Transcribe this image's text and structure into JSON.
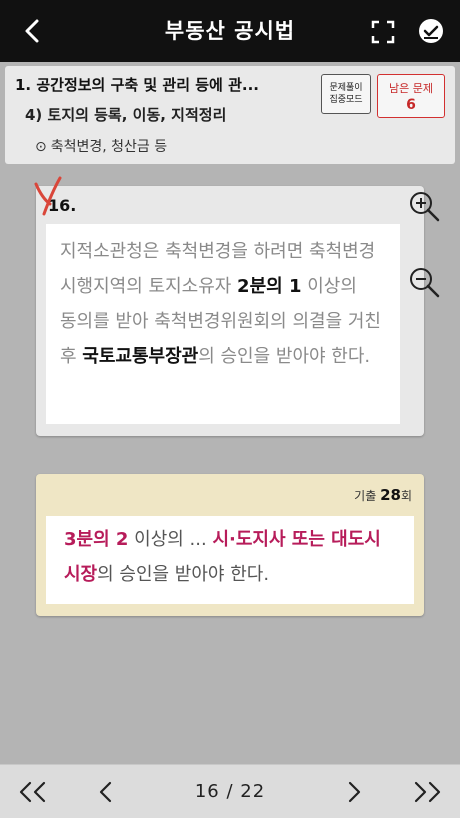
{
  "header": {
    "title": "부동산 공시법",
    "back_icon": "chevron-left-icon",
    "fullscreen_icon": "fullscreen-icon",
    "check_icon": "check-circle-icon"
  },
  "breadcrumb": {
    "level1": "1. 공간정보의 구축 및 관리 등에 관...",
    "level2": "4) 토지의 등록, 이동, 지적정리",
    "level3_bullet": "⊙",
    "level3": "축척변경, 청산금 등"
  },
  "focus_mode": {
    "line1": "문제풀이",
    "line2": "집중모드"
  },
  "remaining": {
    "label": "남은 문제",
    "count": "6"
  },
  "question": {
    "number": "16.",
    "mark": "X",
    "part1": "지적소관청은 축척변경을 하려면 축척변경 시행지역의 토지소유자 ",
    "bold1": "2분의 1",
    "part2": " 이상의 동의를 받아 축척변경위원회의 의결을 거친 후 ",
    "bold2": "국토교통부장관",
    "part3": "의 승인을 받아야 한다."
  },
  "answer": {
    "exam_prefix": "기출 ",
    "exam_number": "28",
    "exam_suffix": "회",
    "bold1": "3분의 2",
    "part1": " 이상의 ... ",
    "bold2": "시·도지사 또는 대도시 시장",
    "part2": "의 승인을 받아야 한다."
  },
  "pagination": {
    "current": "16",
    "separator": " / ",
    "total": "22"
  },
  "colors": {
    "topbar": "#111111",
    "answer_highlight": "#b71c5a",
    "remaining_red": "#c62828",
    "answer_card": "#efe6c5"
  }
}
